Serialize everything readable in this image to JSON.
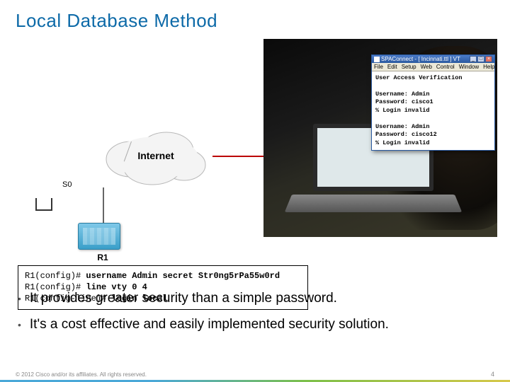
{
  "title": "Local Database Method",
  "diagram": {
    "cloud_label": "Internet",
    "s0_label": "S0",
    "r1_label": "R1"
  },
  "terminal": {
    "window_title": "SPAConnect - [ Incinnati.ttl ] VT",
    "menu": [
      "File",
      "Edit",
      "Setup",
      "Web",
      "Control",
      "Window",
      "Help"
    ],
    "header": "User Access Verification",
    "attempt1_user_line": "Username: Admin",
    "attempt1_pass_line": "Password: cisco1",
    "attempt1_result": "% Login invalid",
    "attempt2_user_line": "Username: Admin",
    "attempt2_pass_line": "Password: cisco12",
    "attempt2_result": "% Login invalid"
  },
  "config": {
    "line1_prompt": "R1(config)# ",
    "line1_cmd": "username Admin secret Str0ng5rPa55w0rd",
    "line2_prompt": "R1(config)# ",
    "line2_cmd": "line vty 0 4",
    "line3_prompt": "R1(config-line)# ",
    "line3_cmd": "login local"
  },
  "bullets": [
    "It provides greater security than a simple password.",
    "It's a cost effective and easily implemented security solution."
  ],
  "footer": {
    "copyright": "© 2012 Cisco and/or its affiliates. All rights reserved.",
    "page": "4"
  }
}
